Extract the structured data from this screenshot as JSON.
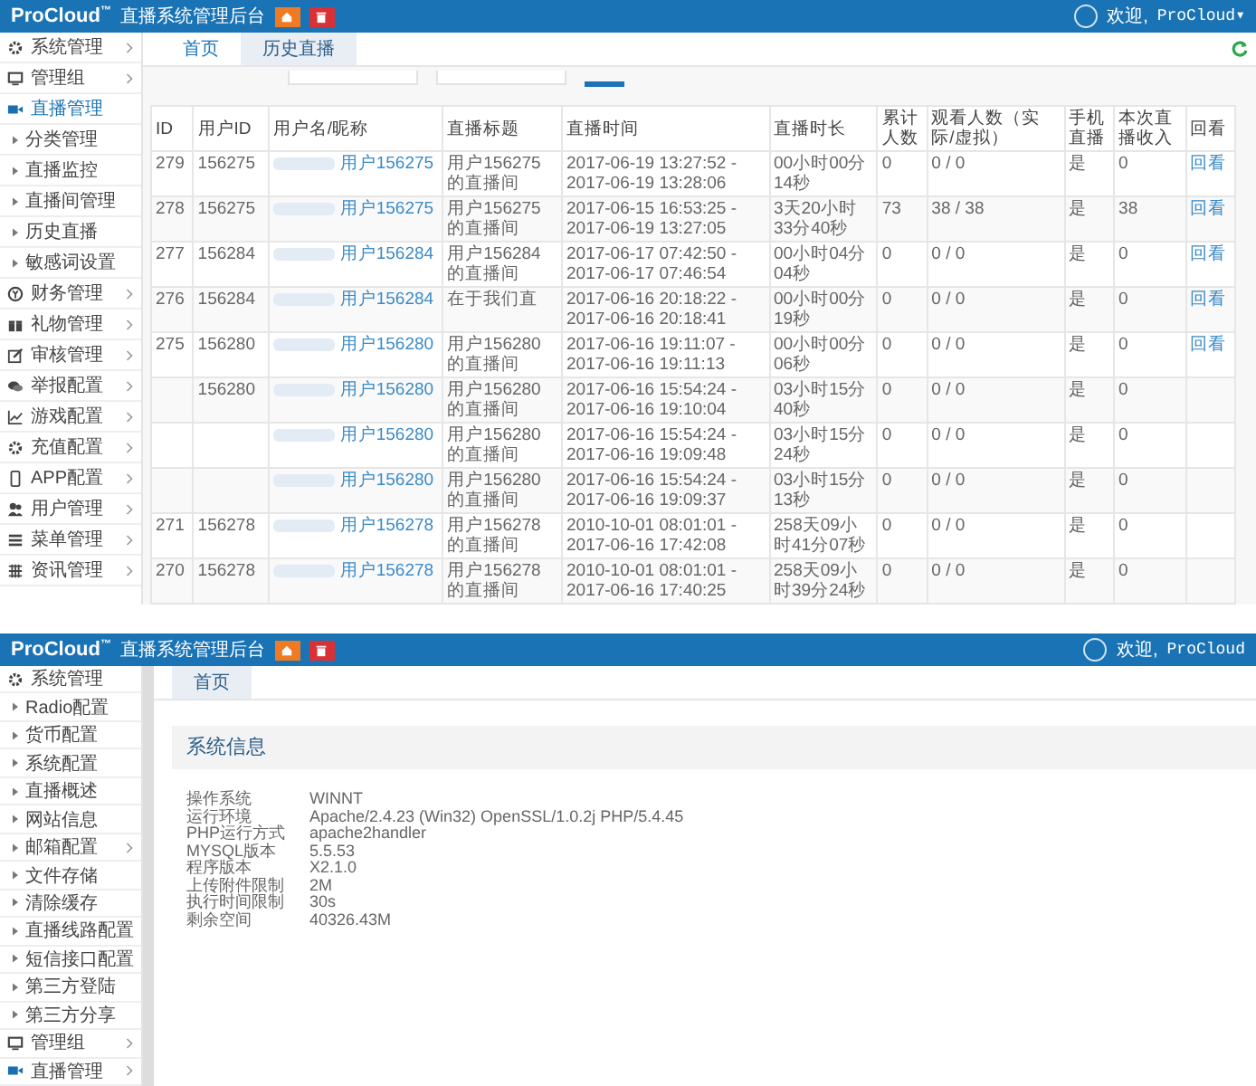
{
  "history_screen": {
    "header": {
      "logo": "ProCloud",
      "logo_mark": "™",
      "title": "直播系统管理后台",
      "greeting": "欢迎,",
      "user": "ProCloud",
      "caret": "▾"
    },
    "sidebar": [
      {
        "label": "系统管理",
        "expanded": false,
        "selected": false
      },
      {
        "label": "管理组",
        "expanded": false,
        "selected": false
      },
      {
        "label": "直播管理",
        "expanded": true,
        "selected": true,
        "children": [
          {
            "label": "分类管理",
            "submenu": false
          },
          {
            "label": "直播监控",
            "submenu": false
          },
          {
            "label": "直播间管理",
            "submenu": false
          },
          {
            "label": "历史直播",
            "submenu": false
          },
          {
            "label": "敏感词设置",
            "submenu": false
          }
        ]
      },
      {
        "label": "财务管理",
        "expanded": false,
        "selected": false
      },
      {
        "label": "礼物管理",
        "expanded": false,
        "selected": false
      },
      {
        "label": "审核管理",
        "expanded": false,
        "selected": false
      },
      {
        "label": "举报配置",
        "expanded": false,
        "selected": false
      },
      {
        "label": "游戏配置",
        "expanded": false,
        "selected": false
      },
      {
        "label": "充值配置",
        "expanded": false,
        "selected": false
      },
      {
        "label": "APP配置",
        "expanded": false,
        "selected": false
      },
      {
        "label": "用户管理",
        "expanded": false,
        "selected": false
      },
      {
        "label": "菜单管理",
        "expanded": false,
        "selected": false
      },
      {
        "label": "资讯管理",
        "expanded": false,
        "selected": false
      }
    ],
    "tabs": [
      {
        "label": "首页",
        "selected": false
      },
      {
        "label": "历史直播",
        "selected": true
      }
    ],
    "table": {
      "columns": [
        "ID",
        "用户ID",
        "用户名/昵称",
        "直播标题",
        "直播时间",
        "直播时长",
        "累计人数",
        "观看人数（实际/虚拟）",
        "手机直播",
        "本次直播收入",
        "回看"
      ],
      "rows": [
        {
          "id": "279",
          "user_id": "156275",
          "username": "用户156275",
          "title": "用户156275的直播间",
          "time": "2017-06-19 13:27:52 - 2017-06-19 13:28:06",
          "duration": "00小时00分14秒",
          "total": "0",
          "viewers": "0 / 0",
          "mobile": "是",
          "income": "0",
          "replay": "回看"
        },
        {
          "id": "278",
          "user_id": "156275",
          "username": "用户156275",
          "title": "用户156275的直播间",
          "time": "2017-06-15 16:53:25 - 2017-06-19 13:27:05",
          "duration": "3天20小时33分40秒",
          "total": "73",
          "viewers": "38 / 38",
          "mobile": "是",
          "income": "38",
          "replay": "回看"
        },
        {
          "id": "277",
          "user_id": "156284",
          "username": "用户156284",
          "title": "用户156284的直播间",
          "time": "2017-06-17 07:42:50 - 2017-06-17 07:46:54",
          "duration": "00小时04分04秒",
          "total": "0",
          "viewers": "0 / 0",
          "mobile": "是",
          "income": "0",
          "replay": "回看"
        },
        {
          "id": "276",
          "user_id": "156284",
          "username": "用户156284",
          "title": "在于我们直",
          "time": "2017-06-16 20:18:22 - 2017-06-16 20:18:41",
          "duration": "00小时00分19秒",
          "total": "0",
          "viewers": "0 / 0",
          "mobile": "是",
          "income": "0",
          "replay": "回看"
        },
        {
          "id": "275",
          "user_id": "156280",
          "username": "用户156280",
          "title": "用户156280的直播间",
          "time": "2017-06-16 19:11:07 - 2017-06-16 19:11:13",
          "duration": "00小时00分06秒",
          "total": "0",
          "viewers": "0 / 0",
          "mobile": "是",
          "income": "0",
          "replay": "回看"
        },
        {
          "user_id": "156280",
          "username": "用户156280",
          "title": "用户156280的直播间",
          "time": "2017-06-16 15:54:24 - 2017-06-16 19:10:04",
          "duration": "03小时15分40秒",
          "total": "0",
          "viewers": "0 / 0",
          "mobile": "是",
          "income": "0"
        },
        {
          "username": "用户156280",
          "title": "用户156280的直播间",
          "time": "2017-06-16 15:54:24 - 2017-06-16 19:09:48",
          "duration": "03小时15分24秒",
          "total": "0",
          "viewers": "0 / 0",
          "mobile": "是",
          "income": "0"
        },
        {
          "username": "用户156280",
          "title": "用户156280的直播间",
          "time": "2017-06-16 15:54:24 - 2017-06-16 19:09:37",
          "duration": "03小时15分13秒",
          "total": "0",
          "viewers": "0 / 0",
          "mobile": "是",
          "income": "0"
        },
        {
          "id": "271",
          "user_id": "156278",
          "username": "用户156278",
          "title": "用户156278的直播间",
          "time": "2010-10-01 08:01:01 - 2017-06-16 17:42:08",
          "duration": "258天09小时41分07秒",
          "total": "0",
          "viewers": "0 / 0",
          "mobile": "是",
          "income": "0"
        },
        {
          "id": "270",
          "user_id": "156278",
          "username": "用户156278",
          "title": "用户156278的直播间",
          "time": "2010-10-01 08:01:01 - 2017-06-16 17:40:25",
          "duration": "258天09小时39分24秒",
          "total": "0",
          "viewers": "0 / 0",
          "mobile": "是",
          "income": "0"
        }
      ]
    }
  },
  "system_screen": {
    "header": {
      "logo": "ProCloud",
      "logo_mark": "™",
      "title": "直播系统管理后台",
      "greeting": "欢迎,",
      "user": "ProCloud"
    },
    "sidebar": [
      {
        "label": "系统管理",
        "expanded": true,
        "selected": false,
        "children": [
          {
            "label": "Radio配置",
            "submenu": false
          },
          {
            "label": "货币配置",
            "submenu": false
          },
          {
            "label": "系统配置",
            "submenu": false
          },
          {
            "label": "直播概述",
            "submenu": false
          },
          {
            "label": "网站信息",
            "submenu": false
          },
          {
            "label": "邮箱配置",
            "submenu": true
          },
          {
            "label": "文件存储",
            "submenu": false
          },
          {
            "label": "清除缓存",
            "submenu": false
          },
          {
            "label": "直播线路配置",
            "submenu": false
          },
          {
            "label": "短信接口配置",
            "submenu": false
          },
          {
            "label": "第三方登陆",
            "submenu": false
          },
          {
            "label": "第三方分享",
            "submenu": false
          }
        ]
      },
      {
        "label": "管理组",
        "expanded": false,
        "selected": false
      },
      {
        "label": "直播管理",
        "expanded": false,
        "selected": false
      }
    ],
    "tabs": [
      {
        "label": "首页",
        "selected": true
      }
    ],
    "panel_title": "系统信息",
    "info": [
      {
        "label": "操作系统",
        "value": "WINNT"
      },
      {
        "label": "运行环境",
        "value": "Apache/2.4.23 (Win32) OpenSSL/1.0.2j PHP/5.4.45"
      },
      {
        "label": "PHP运行方式",
        "value": "apache2handler"
      },
      {
        "label": "MYSQL版本",
        "value": "5.5.53"
      },
      {
        "label": "程序版本",
        "value": "X2.1.0"
      },
      {
        "label": "上传附件限制",
        "value": "2M"
      },
      {
        "label": "执行时间限制",
        "value": "30s"
      },
      {
        "label": "剩余空间",
        "value": "40326.43M"
      }
    ]
  }
}
